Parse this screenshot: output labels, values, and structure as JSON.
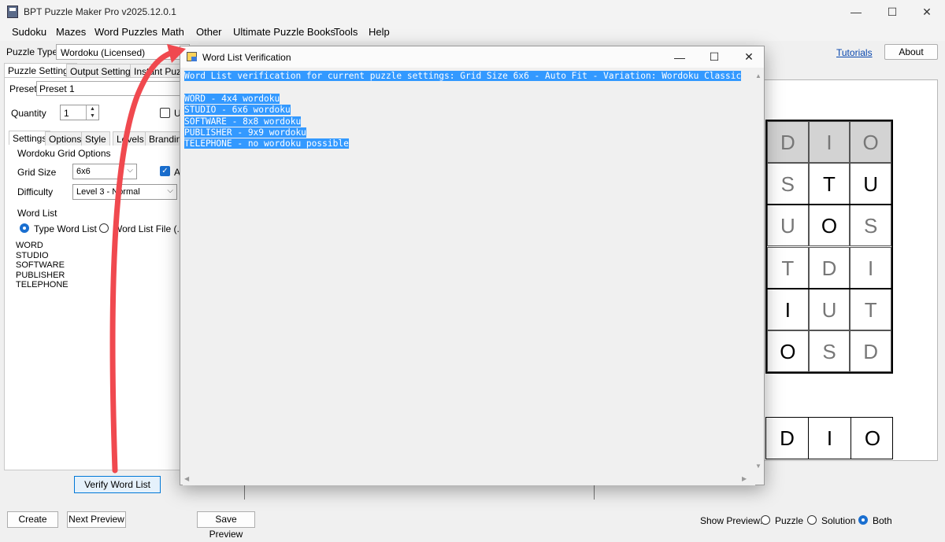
{
  "window": {
    "title": "BPT Puzzle Maker Pro v2025.12.0.1",
    "controls": {
      "minimize": "—",
      "maximize": "☐",
      "close": "✕"
    }
  },
  "menu": [
    "Sudoku",
    "Mazes",
    "Word Puzzles",
    "Math",
    "Other",
    "Ultimate Puzzle Books",
    "Tools",
    "Help"
  ],
  "puzzle_type": {
    "label": "Puzzle Type",
    "value": "Wordoku (Licensed)"
  },
  "top_right": {
    "tutorials": "Tutorials",
    "about": "About"
  },
  "main_tabs": [
    "Puzzle Settings",
    "Output Settings",
    "Instant Puzzle"
  ],
  "preset": {
    "label": "Preset",
    "value": "Preset 1"
  },
  "quantity": {
    "label": "Quantity",
    "value": "1",
    "checkbox_label": "U"
  },
  "sub_tabs": [
    "Settings",
    "Options",
    "Style",
    "Levels",
    "Branding"
  ],
  "grid_options": {
    "title": "Wordoku Grid Options",
    "grid_size_label": "Grid Size",
    "grid_size_value": "6x6",
    "auto_label": "A",
    "difficulty_label": "Difficulty",
    "difficulty_value": "Level 3 - Normal"
  },
  "word_list": {
    "title": "Word List",
    "radio_type": "Type Word List",
    "radio_file": "Word List File (.txt)",
    "words": "WORD\nSTUDIO\nSOFTWARE\nPUBLISHER\nTELEPHONE",
    "verify_button": "Verify Word List"
  },
  "bottom": {
    "create": "Create",
    "next_preview": "Next Preview",
    "save_preview": "Save Preview",
    "show_preview_label": "Show Preview:",
    "options": [
      "Puzzle",
      "Solution",
      "Both"
    ],
    "selected": "Both"
  },
  "preview": {
    "grid": [
      [
        "D",
        "I",
        "O"
      ],
      [
        "S",
        "T",
        "U"
      ],
      [
        "U",
        "O",
        "S"
      ],
      [
        "T",
        "D",
        "I"
      ],
      [
        "I",
        "U",
        "T"
      ],
      [
        "O",
        "S",
        "D"
      ]
    ],
    "given": [
      [
        true,
        true,
        true
      ],
      [
        true,
        false,
        false
      ],
      [
        true,
        false,
        true
      ],
      [
        true,
        true,
        true
      ],
      [
        false,
        true,
        true
      ],
      [
        false,
        true,
        true
      ]
    ],
    "strip": [
      "D",
      "I",
      "O"
    ]
  },
  "dialog": {
    "title": "Word List Verification",
    "lines": [
      "Word List verification for current puzzle settings: Grid Size 6x6 - Auto Fit - Variation: Wordoku Classic",
      "",
      "WORD - 4x4 wordoku",
      "STUDIO - 6x6 wordoku",
      "SOFTWARE - 8x8 wordoku",
      "PUBLISHER - 9x9 wordoku",
      "TELEPHONE - no wordoku possible"
    ],
    "selection_color": "#3399ff"
  },
  "annotation": {
    "arrow_color": "#f0494f"
  }
}
